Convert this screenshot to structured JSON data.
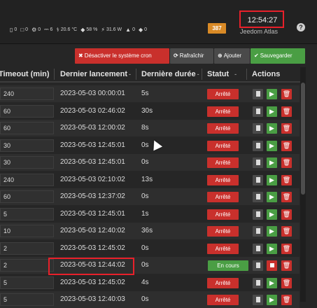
{
  "header": {
    "status_items": [
      {
        "icon": "window-icon",
        "glyph": "▯",
        "value": "0"
      },
      {
        "icon": "door-icon",
        "glyph": "□",
        "value": "0"
      },
      {
        "icon": "light-icon",
        "glyph": "⚙",
        "value": "0"
      },
      {
        "icon": "plug-icon",
        "glyph": "⎓",
        "value": "6"
      },
      {
        "icon": "thermometer-icon",
        "glyph": "⚕",
        "value": "20.6 °C"
      },
      {
        "icon": "humidity-icon",
        "glyph": "◆",
        "value": "58 %"
      },
      {
        "icon": "power-icon",
        "glyph": "⚡",
        "value": "31.6 W"
      },
      {
        "icon": "flame-icon",
        "glyph": "▲",
        "value": "0"
      },
      {
        "icon": "drop-icon",
        "glyph": "◆",
        "value": "0"
      }
    ],
    "message_count": "387",
    "clock": "12:54:27",
    "app_name": "Jeedom Atlas",
    "help_glyph": "?"
  },
  "toolbar": {
    "disable_cron_label": "Désactiver le système cron",
    "refresh_label": "Rafraîchir",
    "add_label": "Ajouter",
    "save_label": "Sauvegarder"
  },
  "table": {
    "columns": {
      "timeout": "Timeout (min)",
      "last_run": "Dernier lancement",
      "last_duration": "Dernière durée",
      "status": "Statut",
      "actions": "Actions"
    },
    "rows": [
      {
        "timeout": "240",
        "last_run": "2023-05-03 00:00:01",
        "duration": "5s",
        "status": "Arrêté"
      },
      {
        "timeout": "60",
        "last_run": "2023-05-03 02:46:02",
        "duration": "30s",
        "status": "Arrêté"
      },
      {
        "timeout": "60",
        "last_run": "2023-05-03 12:00:02",
        "duration": "8s",
        "status": "Arrêté"
      },
      {
        "timeout": "30",
        "last_run": "2023-05-03 12:45:01",
        "duration": "0s",
        "status": "Arrêté"
      },
      {
        "timeout": "30",
        "last_run": "2023-05-03 12:45:01",
        "duration": "0s",
        "status": "Arrêté"
      },
      {
        "timeout": "240",
        "last_run": "2023-05-03 02:10:02",
        "duration": "13s",
        "status": "Arrêté"
      },
      {
        "timeout": "60",
        "last_run": "2023-05-03 12:37:02",
        "duration": "0s",
        "status": "Arrêté"
      },
      {
        "timeout": "5",
        "last_run": "2023-05-03 12:45:01",
        "duration": "1s",
        "status": "Arrêté"
      },
      {
        "timeout": "10",
        "last_run": "2023-05-03 12:40:02",
        "duration": "36s",
        "status": "Arrêté"
      },
      {
        "timeout": "2",
        "last_run": "2023-05-03 12:45:02",
        "duration": "0s",
        "status": "Arrêté"
      },
      {
        "timeout": "2",
        "last_run": "2023-05-03 12:44:02",
        "duration": "0s",
        "status": "En cours"
      },
      {
        "timeout": "5",
        "last_run": "2023-05-03 12:45:02",
        "duration": "4s",
        "status": "Arrêté"
      },
      {
        "timeout": "5",
        "last_run": "2023-05-03 12:40:03",
        "duration": "0s",
        "status": "Arrêté"
      }
    ]
  },
  "colors": {
    "danger": "#c9302c",
    "success": "#4a9e44",
    "warning": "#d98a26",
    "highlight": "#e8202a"
  }
}
